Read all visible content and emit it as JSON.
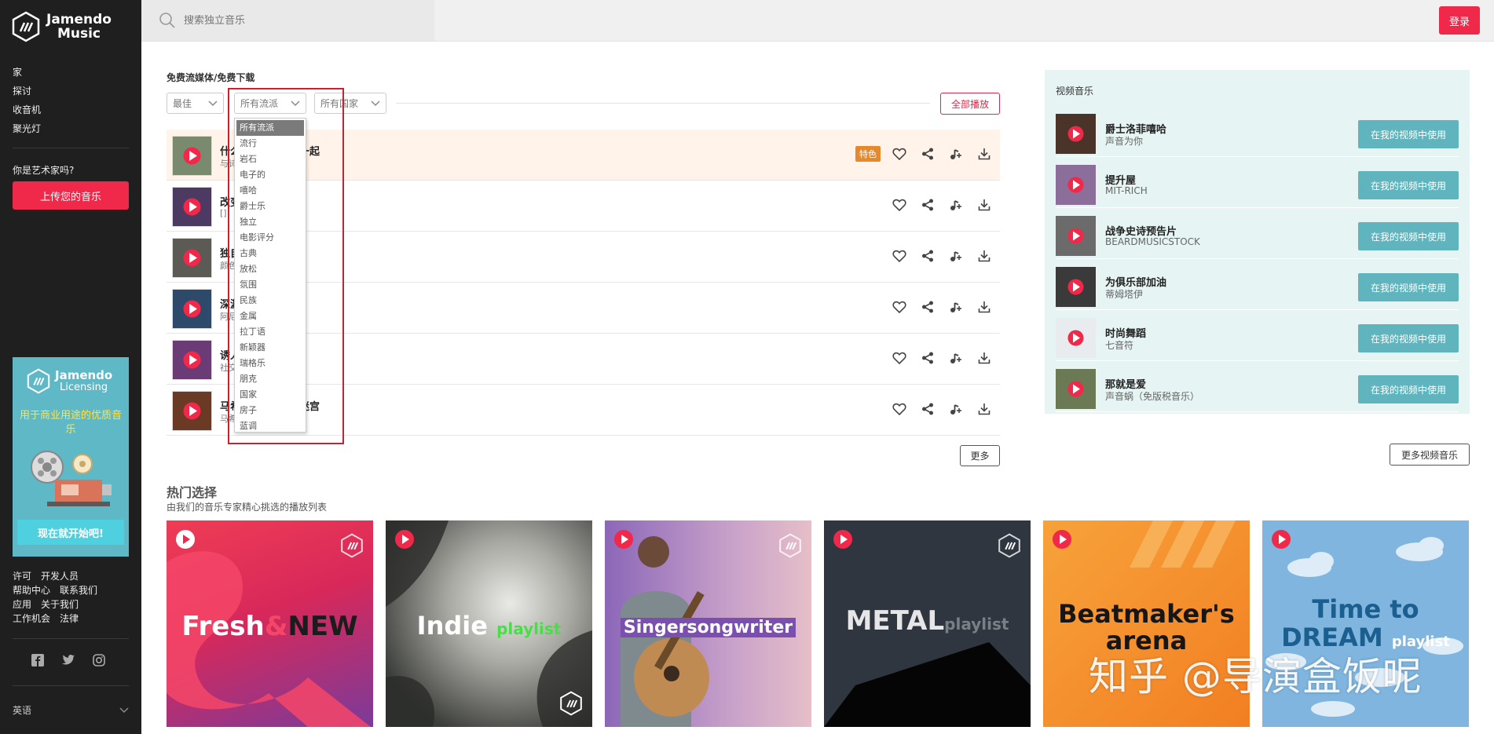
{
  "brand": {
    "name_line1": "Jamendo",
    "name_line2": "Music",
    "accent": "#f0284a",
    "teal": "#5fb4bd"
  },
  "sidebar": {
    "nav": [
      "家",
      "探讨",
      "收音机",
      "聚光灯"
    ],
    "artist_question": "你是艺术家吗?",
    "upload_label": "上传您的音乐",
    "licensing": {
      "name_line1": "Jamendo",
      "name_line2": "Licensing",
      "tagline": "用于商业用途的优质音乐",
      "cta": "现在就开始吧!"
    },
    "footer_links": [
      [
        "许可",
        "开发人员"
      ],
      [
        "帮助中心",
        "联系我们"
      ],
      [
        "应用",
        "关于我们"
      ],
      [
        "工作机会",
        "法律"
      ]
    ],
    "socials": [
      "facebook-icon",
      "twitter-icon",
      "instagram-icon"
    ],
    "language": "英语"
  },
  "header": {
    "search_placeholder": "搜索独立音乐",
    "login_label": "登录"
  },
  "filters": {
    "section_label": "免费流媒体/免费下载",
    "sort": "最佳",
    "genre": "所有流派",
    "country": "所有国家",
    "play_all": "全部播放",
    "genre_options": [
      "所有流派",
      "流行",
      "岩石",
      "电子的",
      "嘻哈",
      "爵士乐",
      "独立",
      "电影评分",
      "古典",
      "放松",
      "氛围",
      "民族",
      "金属",
      "拉丁语",
      "新颖器",
      "瑞格乐",
      "朋克",
      "国家",
      "房子",
      "蓝调"
    ]
  },
  "tracks": [
    {
      "title_pre": "什么",
      "title_post": "在一起",
      "artist": "与诗",
      "featured": true,
      "badge": "特色",
      "cover": "#7a8a6e"
    },
    {
      "title_pre": "改变",
      "title_post": "",
      "artist": "[]",
      "featured": false,
      "badge": "",
      "cover": "#4d3a63"
    },
    {
      "title_pre": "独自",
      "title_post": "",
      "artist": "颜色",
      "featured": false,
      "badge": "",
      "cover": "#5b5a55"
    },
    {
      "title_pre": "深渊",
      "title_post": "",
      "artist": "阿尼",
      "featured": false,
      "badge": "",
      "cover": "#2d4a6b"
    },
    {
      "title_pre": "诱人",
      "title_post": "",
      "artist": "社交",
      "featured": false,
      "badge": "",
      "cover": "#6a3b74"
    },
    {
      "title_pre": "马希",
      "title_post": "的迷宫",
      "artist": "马希",
      "featured": false,
      "badge": "",
      "cover": "#6b3a24"
    }
  ],
  "more_label": "更多",
  "video_music": {
    "title": "视频音乐",
    "use_label": "在我的视频中使用",
    "more_label": "更多视频音乐",
    "items": [
      {
        "name": "爵士洛菲嘻哈",
        "artist": "声音为你",
        "cover": "#4a3328"
      },
      {
        "name": "提升屋",
        "artist": "MIT-RICH",
        "cover": "#8b6f9a"
      },
      {
        "name": "战争史诗预告片",
        "artist": "BEARDMUSICSTOCK",
        "cover": "#6b6b6b"
      },
      {
        "name": "为俱乐部加油",
        "artist": "蒂姆塔伊",
        "cover": "#3a3a3a"
      },
      {
        "name": "时尚舞蹈",
        "artist": "七音符",
        "cover": "#e8ecef"
      },
      {
        "name": "那就是爱",
        "artist": "声音蜗（免版税音乐）",
        "cover": "#6b7a55"
      }
    ]
  },
  "picks": {
    "title": "热门选择",
    "subtitle": "由我们的音乐专家精心挑选的播放列表",
    "items": [
      {
        "main": "Fresh",
        "amp": "&",
        "second": "NEW",
        "bg": "#e8334f"
      },
      {
        "main": "Indie",
        "second": "playlist",
        "bg": "#3a3d3a"
      },
      {
        "main": "Singersongwriter",
        "bg": "#9b6fb3"
      },
      {
        "main": "METAL",
        "second": "playlist",
        "bg": "#2f363f"
      },
      {
        "main": "Beatmaker's",
        "second": "arena",
        "bg": "#f6932a"
      },
      {
        "main": "Time to",
        "second": "DREAM",
        "third": "playlist",
        "bg": "#7fb5de"
      }
    ]
  },
  "watermark": "知乎 @导演盒饭呢"
}
